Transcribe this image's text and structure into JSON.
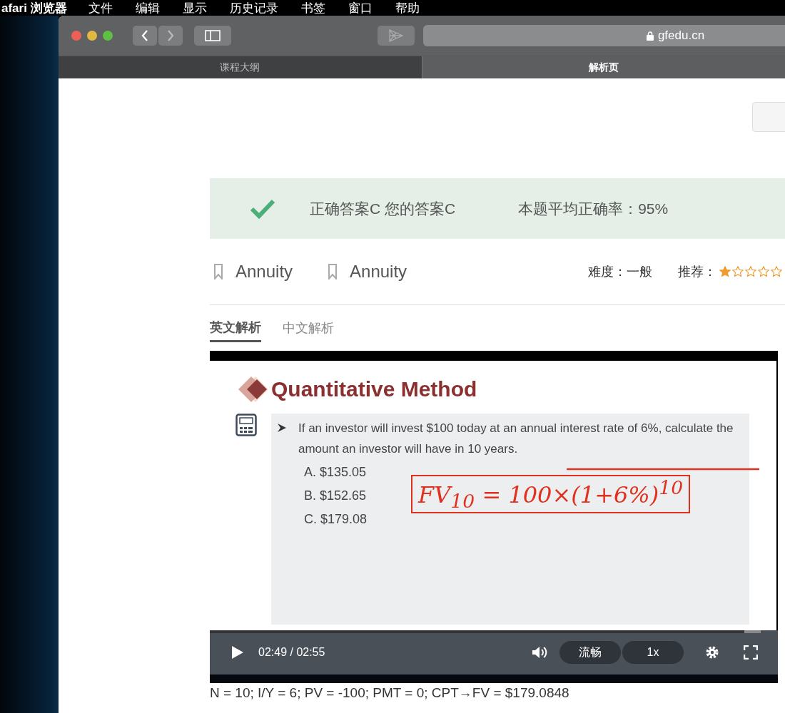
{
  "menu_bar": {
    "app": "afari 浏览器",
    "items": [
      "文件",
      "编辑",
      "显示",
      "历史记录",
      "书签",
      "窗口",
      "帮助"
    ]
  },
  "browser": {
    "url": "gfedu.cn",
    "tabs": [
      {
        "label": "课程大纲",
        "selected": false
      },
      {
        "label": "解析页",
        "selected": true
      }
    ]
  },
  "result": {
    "answers": "正确答案C 您的答案C",
    "accuracy": "本题平均正确率：95%"
  },
  "tags": [
    "Annuity",
    "Annuity"
  ],
  "difficulty": "难度：一般",
  "recommend": {
    "label": "推荐：",
    "stars": 1
  },
  "analysis_tabs": [
    {
      "label": "英文解析",
      "selected": true
    },
    {
      "label": "中文解析",
      "selected": false
    }
  ],
  "video": {
    "slide": {
      "title": "Quantitative Method",
      "question": "If an investor will invest $100 today at an annual interest rate of 6%, calculate the amount an investor will have in 10 years.",
      "options": [
        "A.  $135.05",
        "B.  $152.65",
        "C.  $179.08"
      ],
      "handwriting": "FV$_{10}$ = 100×(1+6%)$^{10}$"
    },
    "controls": {
      "time": "02:49 / 02:55",
      "quality": "流畅",
      "speed": "1x",
      "level": 0.97
    }
  },
  "calculation": "N = 10; I/Y = 6; PV = -100; PMT = 0; CPT→FV = $179.0848"
}
